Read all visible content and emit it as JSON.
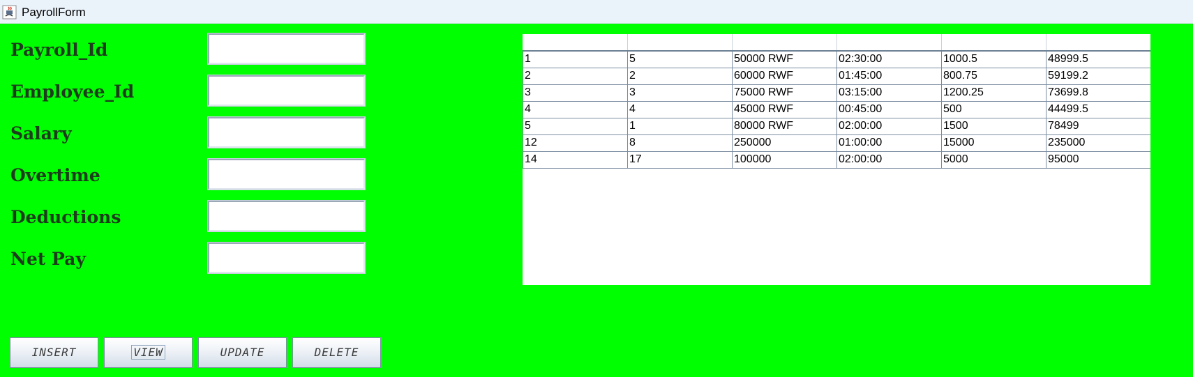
{
  "window": {
    "title": "PayrollForm"
  },
  "form": {
    "fields": [
      {
        "label": "Payroll_Id",
        "value": ""
      },
      {
        "label": "Employee_Id",
        "value": ""
      },
      {
        "label": "Salary",
        "value": ""
      },
      {
        "label": "Overtime",
        "value": ""
      },
      {
        "label": "Deductions",
        "value": ""
      },
      {
        "label": "Net Pay",
        "value": ""
      }
    ]
  },
  "table": {
    "headers": [
      "",
      "",
      "",
      "",
      "",
      ""
    ],
    "rows": [
      [
        "1",
        "5",
        "50000 RWF",
        "02:30:00",
        "1000.5",
        "48999.5"
      ],
      [
        "2",
        "2",
        "60000 RWF",
        "01:45:00",
        "800.75",
        "59199.2"
      ],
      [
        "3",
        "3",
        "75000 RWF",
        "03:15:00",
        "1200.25",
        "73699.8"
      ],
      [
        "4",
        "4",
        "45000 RWF",
        "00:45:00",
        "500",
        "44499.5"
      ],
      [
        "5",
        "1",
        "80000 RWF",
        "02:00:00",
        "1500",
        "78499"
      ],
      [
        "12",
        "8",
        "250000",
        "01:00:00",
        "15000",
        "235000"
      ],
      [
        "14",
        "17",
        "100000",
        "02:00:00",
        "5000",
        "95000"
      ]
    ]
  },
  "buttons": {
    "insert": "INSERT",
    "view": "VIEW",
    "update": "UPDATE",
    "delete": "DELETE"
  },
  "colors": {
    "background": "#00ff00",
    "label_text": "#1e3b1e",
    "titlebar": "#eaf2fa"
  },
  "icons": {
    "app": "java-coffee-cup-icon"
  }
}
